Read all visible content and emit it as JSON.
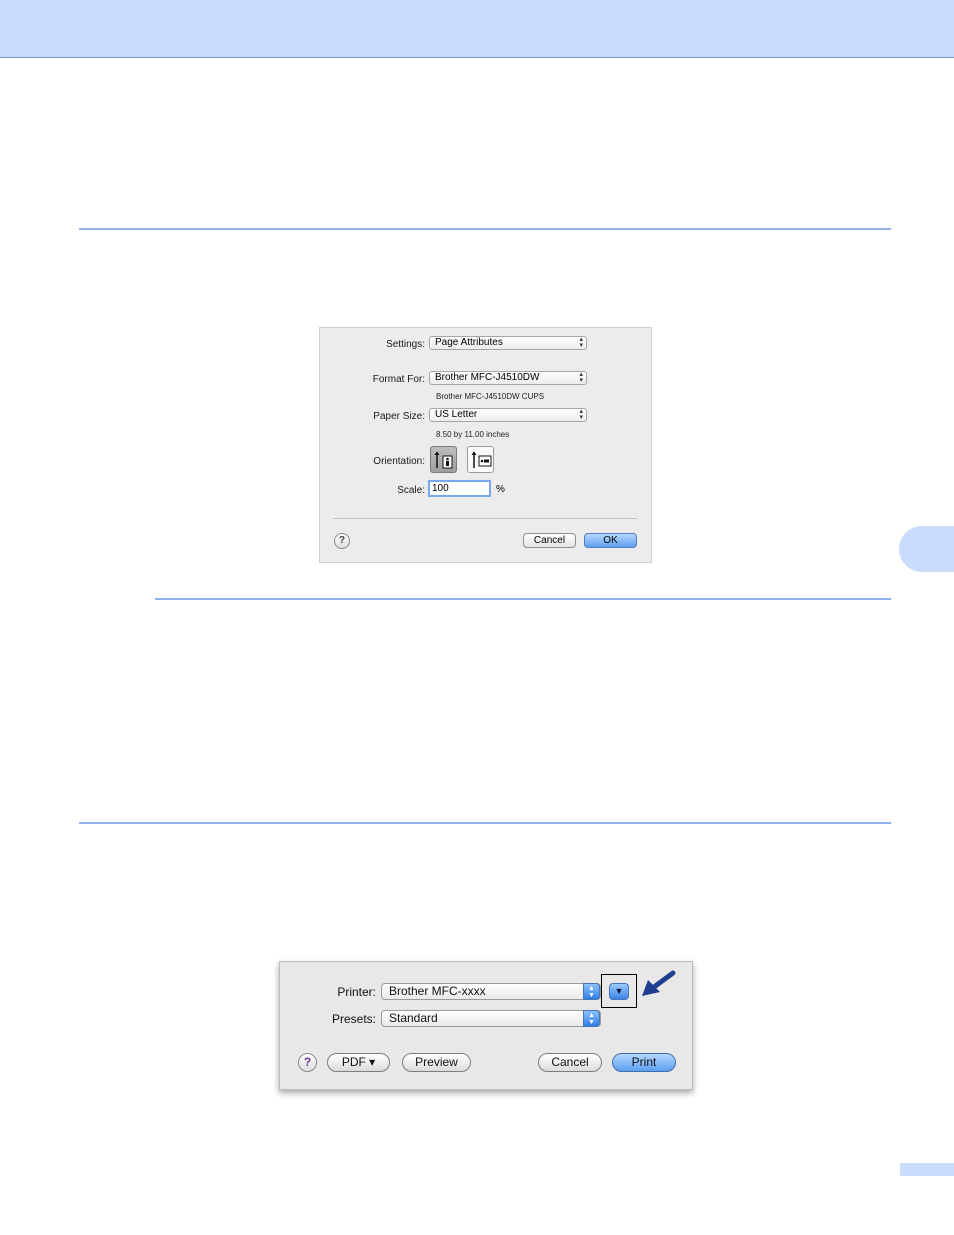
{
  "page_setup_dialog": {
    "settings_label": "Settings:",
    "settings_value": "Page Attributes",
    "format_for_label": "Format For:",
    "format_for_value": "Brother MFC-J4510DW",
    "format_for_note": "Brother MFC-J4510DW CUPS",
    "paper_size_label": "Paper Size:",
    "paper_size_value": "US Letter",
    "paper_size_note": "8.50 by 11.00 inches",
    "orientation_label": "Orientation:",
    "orientation_options": [
      "portrait",
      "landscape"
    ],
    "orientation_selected": "portrait",
    "scale_label": "Scale:",
    "scale_value": "100",
    "scale_unit": "%",
    "help_glyph": "?",
    "cancel_label": "Cancel",
    "ok_label": "OK"
  },
  "print_dialog": {
    "printer_label": "Printer:",
    "printer_value": "Brother MFC-xxxx",
    "presets_label": "Presets:",
    "presets_value": "Standard",
    "help_glyph": "?",
    "pdf_label": "PDF ▾",
    "preview_label": "Preview",
    "cancel_label": "Cancel",
    "print_label": "Print",
    "disclosure_glyph": "▼"
  },
  "colors": {
    "header_band": "#c9dcfb",
    "rule": "#8fb1ec",
    "callout_arrow": "#1f3f8f"
  },
  "icons": {
    "popup_arrows": "up-down-arrows-icon",
    "callout_arrow": "blue-pointer-arrow-icon",
    "help": "question-mark-icon"
  }
}
